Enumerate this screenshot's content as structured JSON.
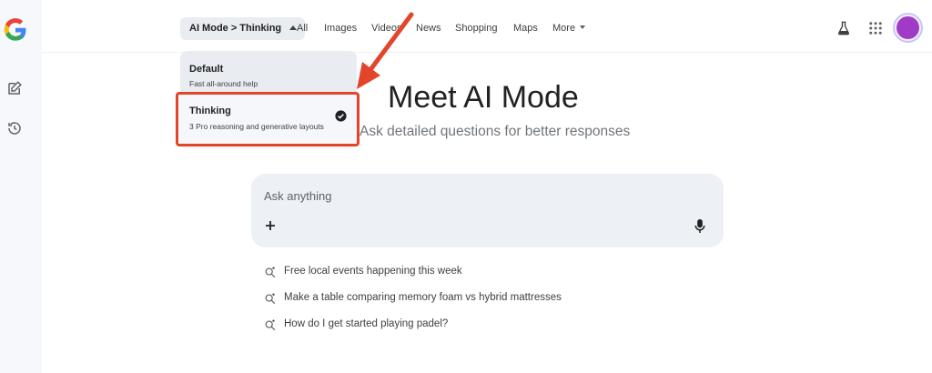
{
  "header": {
    "mode_selector": "AI Mode > Thinking",
    "tabs": [
      "All",
      "Images",
      "Videos",
      "News",
      "Shopping",
      "Maps",
      "More"
    ]
  },
  "mode_menu": {
    "options": [
      {
        "title": "Default",
        "description": "Fast all-around help",
        "selected": false
      },
      {
        "title": "Thinking",
        "description": "3 Pro reasoning and generative layouts",
        "selected": true
      }
    ]
  },
  "hero": {
    "title": "Meet AI Mode",
    "subtitle": "Ask detailed questions for better responses"
  },
  "prompt": {
    "placeholder": "Ask anything",
    "plus_label": "+"
  },
  "suggestions": [
    "Free local events happening this week",
    "Make a table comparing memory foam vs hybrid mattresses",
    "How do I get started playing padel?"
  ],
  "icons": {
    "logo": "google-g-logo",
    "rail": [
      "new-chat-icon",
      "history-icon"
    ],
    "top_right": [
      "labs-flask-icon",
      "apps-grid-icon",
      "avatar"
    ],
    "suggestion": "search-sparkle-icon",
    "mic": "mic-icon",
    "check": "checkmark-circle-icon"
  },
  "colors": {
    "annotation": "#e2452a",
    "avatar": "#a03bc8",
    "pill_bg": "#e9ecf1",
    "prompt_bg": "#edf0f4"
  }
}
